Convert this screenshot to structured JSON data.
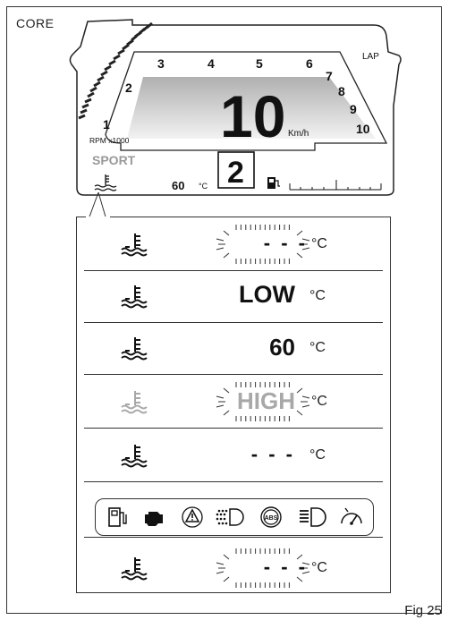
{
  "header": {
    "core_label": "CORE",
    "figure_label": "Fig 25"
  },
  "dashboard": {
    "rpm_ticks": [
      "1",
      "2",
      "3",
      "4",
      "5",
      "6",
      "7",
      "8",
      "9",
      "10"
    ],
    "rpm_unit": "RPM x1000",
    "lap_label": "LAP",
    "speed_value": "10",
    "speed_unit": "Km/h",
    "riding_mode": "SPORT",
    "coolant_temp_value": "60",
    "coolant_temp_unit": "°C",
    "gear": "2"
  },
  "temp_rows": [
    {
      "value": "- - -",
      "unit": "°C",
      "flashing": true,
      "dimmed": false
    },
    {
      "value": "LOW",
      "unit": "°C",
      "flashing": false,
      "dimmed": false
    },
    {
      "value": "60",
      "unit": "°C",
      "flashing": false,
      "dimmed": false
    },
    {
      "value": "HIGH",
      "unit": "°C",
      "flashing": true,
      "dimmed": true
    },
    {
      "value": "- - -",
      "unit": "°C",
      "flashing": false,
      "dimmed": false
    },
    {
      "value": "- - -",
      "unit": "°C",
      "flashing": true,
      "dimmed": false
    }
  ],
  "warning_icons": [
    "fuel-reserve-icon",
    "engine-check-icon",
    "general-warning-icon",
    "position-lights-icon",
    "abs-icon",
    "high-beam-icon",
    "service-icon"
  ],
  "colors": {
    "display_gradient_top": "#b0b0b0",
    "display_gradient_bottom": "#f2f2f2",
    "dimmed": "#a8a8a8"
  }
}
